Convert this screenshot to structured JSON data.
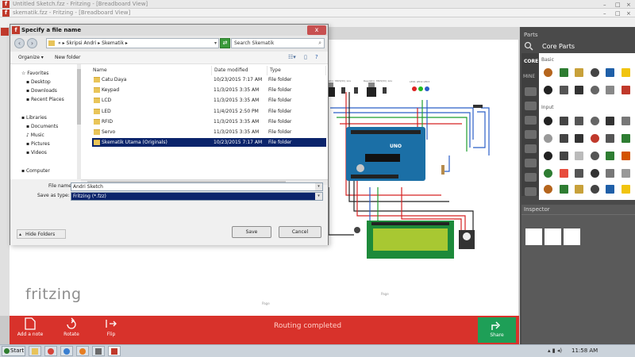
{
  "background_windows": {
    "window1_title": "Untitled Sketch.fzz - Fritzing - [Breadboard View]",
    "window2_title": "skematik.fzz - Fritzing - [Breadboard View]",
    "breadboard_tab": "ode"
  },
  "canvas": {
    "logo": "fritzing",
    "labels": {
      "regulator_left": "Regulator 7805(5V) 1Ax",
      "regulator_right": "Regulator 7805(5V) 1Ax",
      "led_label": "LED1 LED2 LED3",
      "arduino_label": "UNO",
      "footer_left": "Page",
      "footer_right": "Page"
    }
  },
  "bottom_toolbar": {
    "add_note": "Add a note",
    "rotate": "Rotate",
    "flip": "Flip",
    "status": "Routing completed",
    "share": "Share"
  },
  "parts_panel": {
    "title": "Parts",
    "bin_name": "Core Parts",
    "core_tag": "CORE",
    "mine_tag": "MINE",
    "section_basic": "Basic",
    "section_input": "Input"
  },
  "inspector": {
    "title": "Inspector"
  },
  "dialog": {
    "title": "Specify a file name",
    "close": "x",
    "breadcrumb": {
      "root": "«",
      "crumb1": "Skripsi Andri",
      "crumb2": "Skematik"
    },
    "search_placeholder": "Search Skematik",
    "toolbar": {
      "organize": "Organize",
      "new_folder": "New folder"
    },
    "nav": {
      "favorites": "Favorites",
      "desktop": "Desktop",
      "downloads": "Downloads",
      "recent_places": "Recent Places",
      "libraries": "Libraries",
      "documents": "Documents",
      "music": "Music",
      "pictures": "Pictures",
      "videos": "Videos",
      "computer": "Computer"
    },
    "columns": {
      "name": "Name",
      "date": "Date modified",
      "type": "Type"
    },
    "files": [
      {
        "name": "Catu Daya",
        "date": "10/23/2015 7:17 AM",
        "type": "File folder"
      },
      {
        "name": "Keypad",
        "date": "11/3/2015 3:35 AM",
        "type": "File folder"
      },
      {
        "name": "LCD",
        "date": "11/3/2015 3:35 AM",
        "type": "File folder"
      },
      {
        "name": "LED",
        "date": "11/4/2015 2:50 PM",
        "type": "File folder"
      },
      {
        "name": "RFID",
        "date": "11/3/2015 3:35 AM",
        "type": "File folder"
      },
      {
        "name": "Servo",
        "date": "11/3/2015 3:35 AM",
        "type": "File folder"
      },
      {
        "name": "Skematik Utama (Originals)",
        "date": "10/23/2015 7:17 AM",
        "type": "File folder"
      }
    ],
    "file_name_label": "File name:",
    "file_name_value": "Andri Sketch",
    "save_type_label": "Save as type:",
    "save_type_value": "Fritzing (*.fzz)",
    "hide_folders": "Hide Folders",
    "save": "Save",
    "cancel": "Cancel"
  },
  "taskbar": {
    "start": "Start",
    "clock": "11:58 AM"
  }
}
